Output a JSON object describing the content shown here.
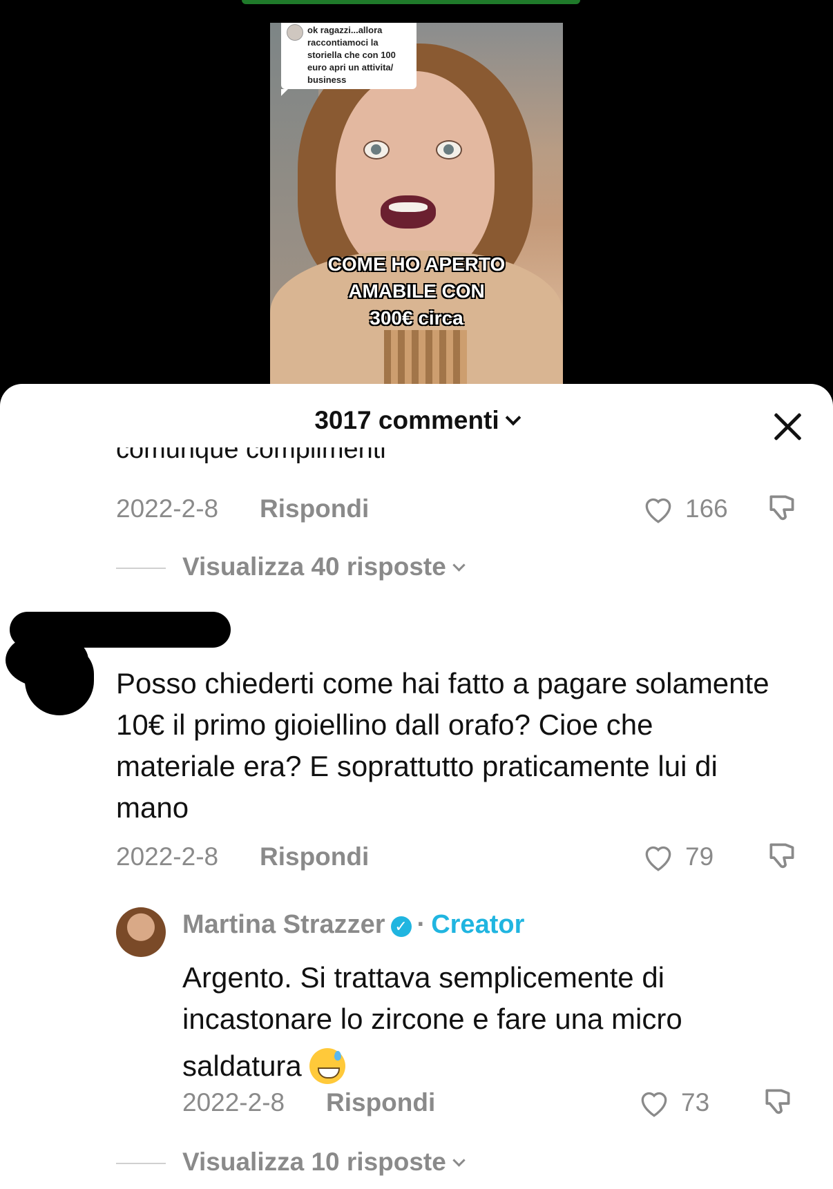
{
  "video": {
    "question_bubble": "ok ragazzi...allora raccontiamoci la storiella che con 100 euro apri un attivita/ business",
    "overlay_line1": "COME HO APERTO",
    "overlay_line2": "AMABILE CON",
    "overlay_line3": "300€ circa"
  },
  "comments_sheet": {
    "title": "3017 commenti",
    "cut_off_text": "comunque complimenti"
  },
  "comment1": {
    "date": "2022-2-8",
    "reply_label": "Rispondi",
    "likes": "166",
    "view_replies": "Visualizza 40 risposte"
  },
  "comment2": {
    "text": "Posso chiederti come hai fatto a pagare solamente 10€ il primo gioiellino dall orafo? Cioe che materiale era? E soprattutto praticamente lui di mano",
    "date": "2022-2-8",
    "reply_label": "Rispondi",
    "likes": "79"
  },
  "creator_reply": {
    "author": "Martina Strazzer",
    "tag": "Creator",
    "separator": "·",
    "text": "Argento. Si trattava semplicemente di incastonare lo zircone e fare una micro saldatura",
    "date": "2022-2-8",
    "reply_label": "Rispondi",
    "likes": "73",
    "view_replies": "Visualizza 10 risposte"
  },
  "icons": [
    "heart-icon",
    "dislike-icon",
    "close-icon",
    "chevron-down-icon",
    "verified-badge-icon",
    "sweat-smile-emoji"
  ]
}
